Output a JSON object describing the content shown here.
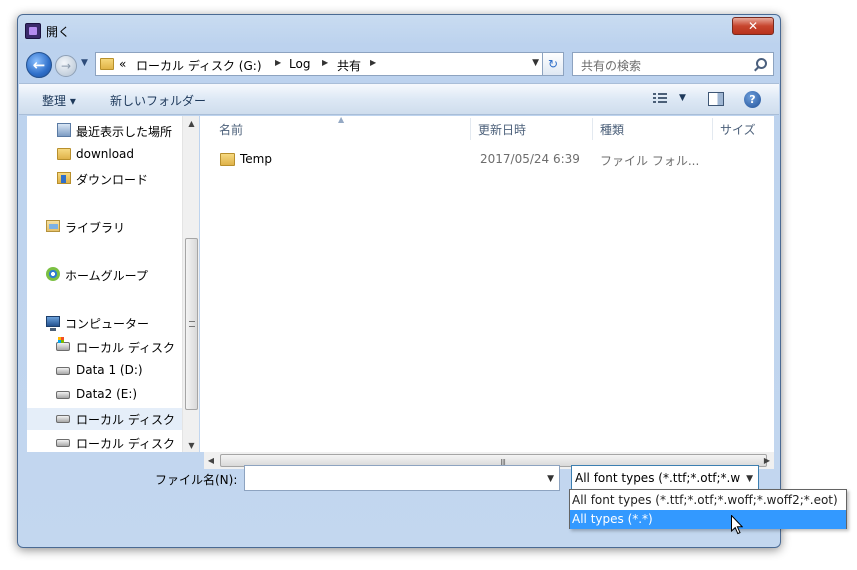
{
  "window": {
    "title": "開く",
    "close_label": "✕"
  },
  "address": {
    "recent_symbol": "«",
    "segments": [
      "ローカル ディスク (G:)",
      "Log",
      "共有"
    ],
    "search_placeholder": "共有の検索"
  },
  "toolbar": {
    "organize_label": "整理 ▾",
    "new_folder_label": "新しいフォルダー"
  },
  "sidebar": {
    "items": [
      {
        "label": "最近表示した場所",
        "icon": "recent-places-icon"
      },
      {
        "label": "download",
        "icon": "folder-icon"
      },
      {
        "label": "ダウンロード",
        "icon": "downloads-folder-icon"
      },
      {
        "label": "ライブラリ",
        "icon": "library-icon"
      },
      {
        "label": "ホームグループ",
        "icon": "homegroup-icon"
      },
      {
        "label": "コンピューター",
        "icon": "computer-icon"
      },
      {
        "label": "ローカル ディスク",
        "icon": "system-drive-icon"
      },
      {
        "label": "Data 1 (D:)",
        "icon": "drive-icon"
      },
      {
        "label": "Data2 (E:)",
        "icon": "drive-icon"
      },
      {
        "label": "ローカル ディスク",
        "icon": "drive-icon",
        "selected": true
      },
      {
        "label": "ローカル ディスク",
        "icon": "drive-icon"
      }
    ]
  },
  "filelist": {
    "columns": [
      "名前",
      "更新日時",
      "種類",
      "サイズ"
    ],
    "rows": [
      {
        "name": "Temp",
        "date": "2017/05/24 6:39",
        "type": "ファイル フォル..."
      }
    ]
  },
  "bottom": {
    "filename_label": "ファイル名(N):",
    "filename_value": "",
    "filetype_selected": "All font types (*.ttf;*.otf;*.w",
    "filetype_options": [
      "All font types (*.ttf;*.otf;*.woff;*.woff2;*.eot)",
      "All types (*.*)"
    ],
    "highlighted_option_index": 1
  },
  "colors": {
    "highlight": "#3399ff",
    "titlebar": "#c9dcf1",
    "close_button": "#c7452e"
  }
}
